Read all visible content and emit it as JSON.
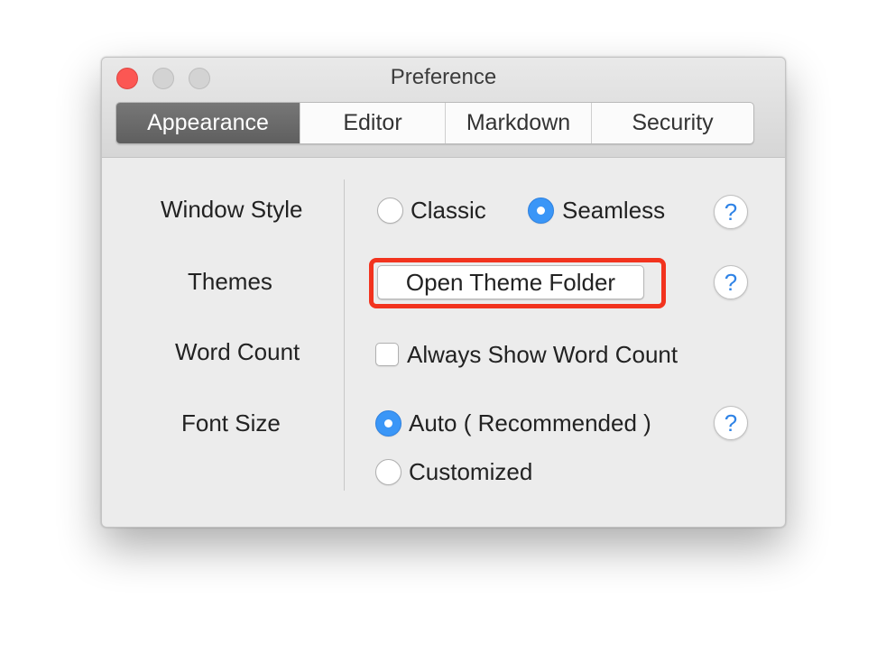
{
  "window": {
    "title": "Preference"
  },
  "tabs": [
    {
      "label": "Appearance",
      "active": true
    },
    {
      "label": "Editor",
      "active": false
    },
    {
      "label": "Markdown",
      "active": false
    },
    {
      "label": "Security",
      "active": false
    }
  ],
  "settings": {
    "window_style": {
      "label": "Window Style",
      "options": [
        {
          "label": "Classic",
          "selected": false
        },
        {
          "label": "Seamless",
          "selected": true
        }
      ],
      "help": "?"
    },
    "themes": {
      "label": "Themes",
      "button_label": "Open Theme Folder",
      "help": "?"
    },
    "word_count": {
      "label": "Word Count",
      "checkbox_label": "Always Show Word Count",
      "checked": false
    },
    "font_size": {
      "label": "Font Size",
      "options": [
        {
          "label": "Auto ( Recommended )",
          "selected": true
        },
        {
          "label": "Customized",
          "selected": false
        }
      ],
      "help": "?"
    }
  },
  "colors": {
    "accent": "#3a96f7",
    "highlight": "#f2331e",
    "close": "#fc5753"
  }
}
